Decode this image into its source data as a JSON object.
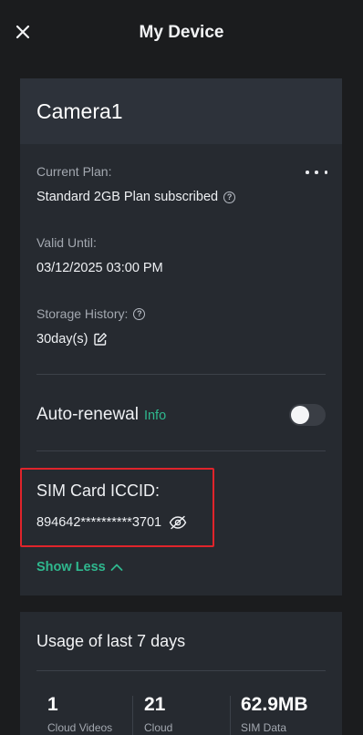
{
  "header": {
    "title": "My Device",
    "close_icon": "close-icon"
  },
  "device": {
    "name": "Camera1",
    "current_plan_label": "Current Plan:",
    "current_plan_value": "Standard 2GB Plan subscribed",
    "valid_until_label": "Valid Until:",
    "valid_until_value": "03/12/2025 03:00 PM",
    "storage_history_label": "Storage History:",
    "storage_history_value": "30day(s)",
    "auto_renewal_label": "Auto-renewal",
    "auto_renewal_info": "Info",
    "auto_renewal_on": false,
    "sim_label": "SIM Card ICCID:",
    "sim_value": "894642**********3701",
    "show_less": "Show Less"
  },
  "usage": {
    "title": "Usage of last 7 days",
    "stats": [
      {
        "value": "1",
        "label": "Cloud Videos"
      },
      {
        "value": "21",
        "label": "Cloud"
      },
      {
        "value": "62.9MB",
        "label": "SIM Data"
      }
    ]
  },
  "colors": {
    "accent": "#2fb88e",
    "highlight": "#e0242b",
    "card": "#262a30",
    "background": "#1b1c1e"
  }
}
